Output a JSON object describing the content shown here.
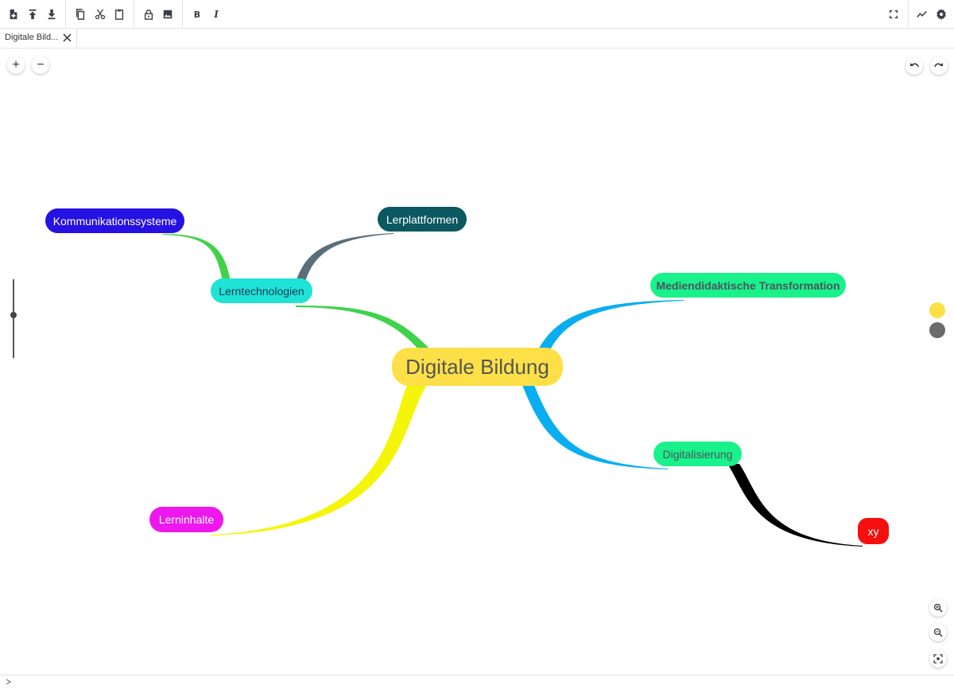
{
  "toolbar": {
    "buttons": [
      {
        "icon": "new-file-icon"
      },
      {
        "icon": "upload-icon"
      },
      {
        "icon": "download-icon"
      },
      {
        "icon": "copy-icon"
      },
      {
        "icon": "cut-icon"
      },
      {
        "icon": "paste-icon"
      },
      {
        "icon": "lock-icon"
      },
      {
        "icon": "image-icon"
      },
      {
        "icon": "bold-icon"
      },
      {
        "icon": "italic-icon"
      },
      {
        "icon": "fullscreen-icon"
      },
      {
        "icon": "chart-line-icon"
      },
      {
        "icon": "gear-icon"
      }
    ],
    "bold_label": "B",
    "italic_label": "I"
  },
  "tabs": [
    {
      "title": "Digitale Bild...",
      "icon": "close-icon"
    }
  ],
  "controls": {
    "expand_label": "+",
    "collapse_label": "−",
    "undo_icon": "undo-icon",
    "redo_icon": "redo-icon",
    "zoom_in_icon": "zoom-in-icon",
    "zoom_out_icon": "zoom-out-icon",
    "fit_icon": "fit-screen-icon"
  },
  "mindmap": {
    "root": {
      "text": "Digitale Bildung",
      "color": "#fde047",
      "text_color": "#555555"
    },
    "nodes": [
      {
        "key": "lerntechnologien",
        "text": "Lerntechnologien",
        "color": "#1ee3d6",
        "text_color": "#1f3b57",
        "edge_color": "#3fd24a"
      },
      {
        "key": "kommunikationssysteme",
        "text": "Kommunikationssysteme",
        "color": "#2611e3",
        "text_color": "#ffffff",
        "edge_color": "#3fd24a"
      },
      {
        "key": "lerplattformen",
        "text": "Lerplattformen",
        "color": "#0b5860",
        "text_color": "#ffffff",
        "edge_color": "#5a6f7a"
      },
      {
        "key": "mediendidaktische",
        "text": "Mediendidaktische Transformation",
        "color": "#19f28a",
        "text_color": "#4b5563",
        "edge_color": "#08aef0"
      },
      {
        "key": "digitalisierung",
        "text": "Digitalisierung",
        "color": "#19f28a",
        "text_color": "#4b5563",
        "edge_color": "#08aef0"
      },
      {
        "key": "xy",
        "text": "xy",
        "color": "#f50f0f",
        "text_color": "#ffffff",
        "edge_color": "#000000"
      },
      {
        "key": "lerninhalte",
        "text": "Lerninhalte",
        "color": "#ee17ee",
        "text_color": "#ffffff",
        "edge_color": "#f5f50a"
      }
    ]
  },
  "color_swatches": [
    "#fde047",
    "#6b6b6b"
  ]
}
